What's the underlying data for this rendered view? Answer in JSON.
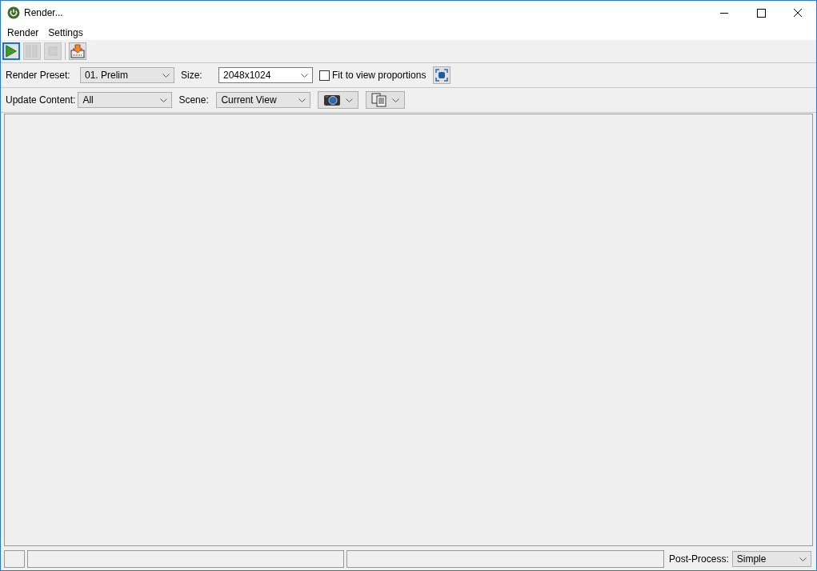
{
  "window": {
    "title": "Render..."
  },
  "menu": [
    "Render",
    "Settings"
  ],
  "toolbar": [
    {
      "kind": "play",
      "disabled": false,
      "selected": true
    },
    {
      "kind": "pause",
      "disabled": true,
      "selected": false
    },
    {
      "kind": "stop",
      "disabled": true,
      "selected": false
    },
    {
      "kind": "export",
      "disabled": false,
      "selected": false
    }
  ],
  "preset_row": {
    "preset_label": "Render Preset:",
    "preset": "01. Prelim",
    "size_label": "Size:",
    "size": "2048x1024",
    "fit_checkbox": {
      "label": "Fit to view proportions",
      "checked": false
    }
  },
  "content_row": {
    "update_label": "Update Content:",
    "update": "All",
    "scene_label": "Scene:",
    "scene": "Current View"
  },
  "status_bar": {
    "post_process_label": "Post-Process:",
    "post_process": "Simple"
  }
}
